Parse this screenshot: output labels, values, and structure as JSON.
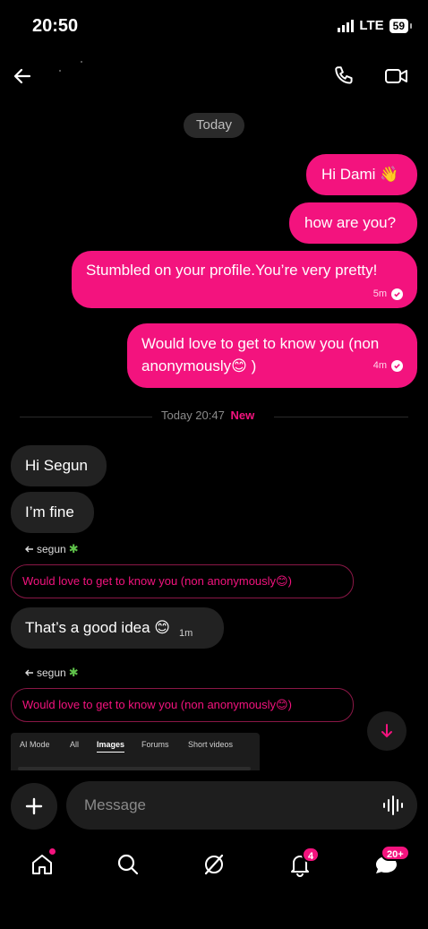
{
  "status_bar": {
    "time": "20:50",
    "network": "LTE",
    "battery": "59"
  },
  "header": {
    "back_icon": "arrow-left-icon",
    "call_icon": "phone-icon",
    "video_icon": "video-icon"
  },
  "date_pill": "Today",
  "outgoing": [
    {
      "text": "Hi Dami 👋",
      "time": ""
    },
    {
      "text": "how are you?",
      "time": ""
    },
    {
      "text": "Stumbled on your profile.You’re very pretty!",
      "time": "5m"
    },
    {
      "text_line1": "Would love to get to know you (non",
      "text_line2": "anonymously😊 )",
      "time": "4m"
    }
  ],
  "divider": {
    "label": "Today 20:47",
    "new_label": "New"
  },
  "incoming": [
    {
      "text": "Hi Segun"
    },
    {
      "text": "I’m fine"
    },
    {
      "text": "That’s a good idea 😊",
      "time": "1m"
    }
  ],
  "replies": [
    {
      "label": "segun",
      "quote": "Would love to get to know you (non anonymously😊)"
    },
    {
      "label": "segun",
      "quote": "Would love to get to know you (non anonymously😊)"
    }
  ],
  "overlay_tabs": [
    "AI Mode",
    "All",
    "Images",
    "Forums",
    "Short videos"
  ],
  "composer": {
    "placeholder": "Message"
  },
  "nav": {
    "notifications_badge": "4",
    "messages_badge": "20+"
  },
  "colors": {
    "accent": "#f3137e",
    "background": "#000000",
    "bubble_in": "#222222"
  }
}
